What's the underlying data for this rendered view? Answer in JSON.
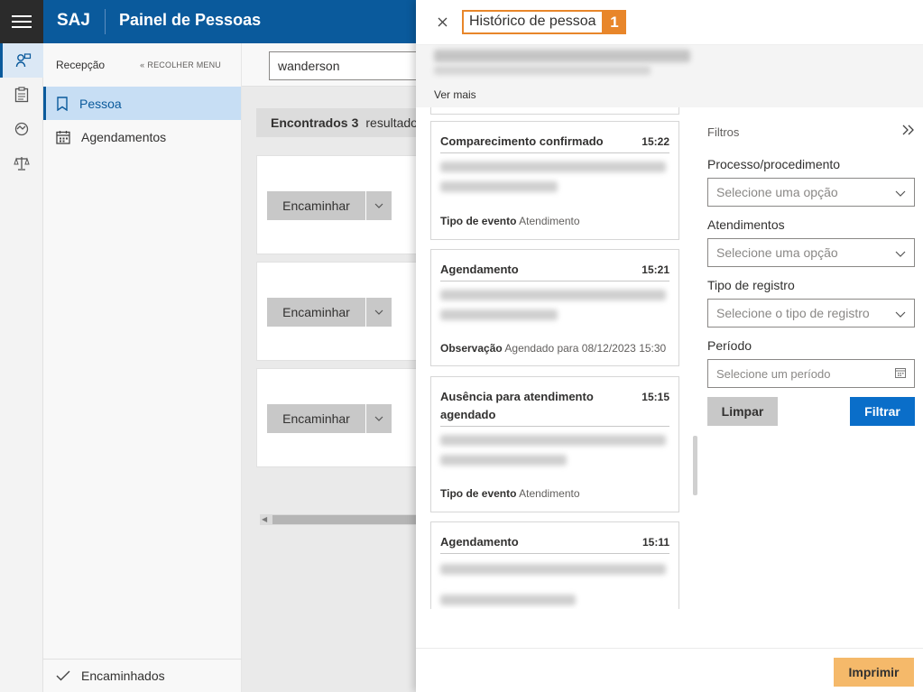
{
  "header": {
    "brand": "SAJ",
    "title": "Painel de Pessoas"
  },
  "sidebar": {
    "section_label": "Recepção",
    "collapse_label": "RECOLHER MENU",
    "items": [
      {
        "label": "Pessoa",
        "icon": "bookmark-icon",
        "active": true
      },
      {
        "label": "Agendamentos",
        "icon": "calendar-icon",
        "active": false
      }
    ],
    "footer_label": "Encaminhados"
  },
  "main": {
    "search_value": "wanderson",
    "found_prefix": "Encontrados",
    "found_count": "3",
    "found_suffix": "resultados",
    "action_label": "Encaminhar"
  },
  "panel": {
    "title": "Histórico de pessoa",
    "badge": "1",
    "see_more": "Ver mais",
    "events": [
      {
        "title": "Comparecimento confirmado",
        "time": "15:22",
        "field_label": "Tipo de evento",
        "field_value": "Atendimento"
      },
      {
        "title": "Agendamento",
        "time": "15:21",
        "field_label": "Observação",
        "field_value": "Agendado para 08/12/2023 15:30"
      },
      {
        "title": "Ausência para atendimento agendado",
        "time": "15:15",
        "field_label": "Tipo de evento",
        "field_value": "Atendimento"
      },
      {
        "title": "Agendamento",
        "time": "15:11"
      }
    ],
    "filters": {
      "heading": "Filtros",
      "process_label": "Processo/procedimento",
      "process_placeholder": "Selecione uma opção",
      "attendance_label": "Atendimentos",
      "attendance_placeholder": "Selecione uma opção",
      "record_type_label": "Tipo de registro",
      "record_type_placeholder": "Selecione o tipo de registro",
      "period_label": "Período",
      "period_placeholder": "Selecione um período",
      "clear_label": "Limpar",
      "filter_label": "Filtrar"
    },
    "print_label": "Imprimir"
  },
  "colors": {
    "brand": "#0a5a9c",
    "primary_button": "#0a6ec9",
    "highlight": "#e8862a",
    "print_button": "#f5b96a"
  }
}
